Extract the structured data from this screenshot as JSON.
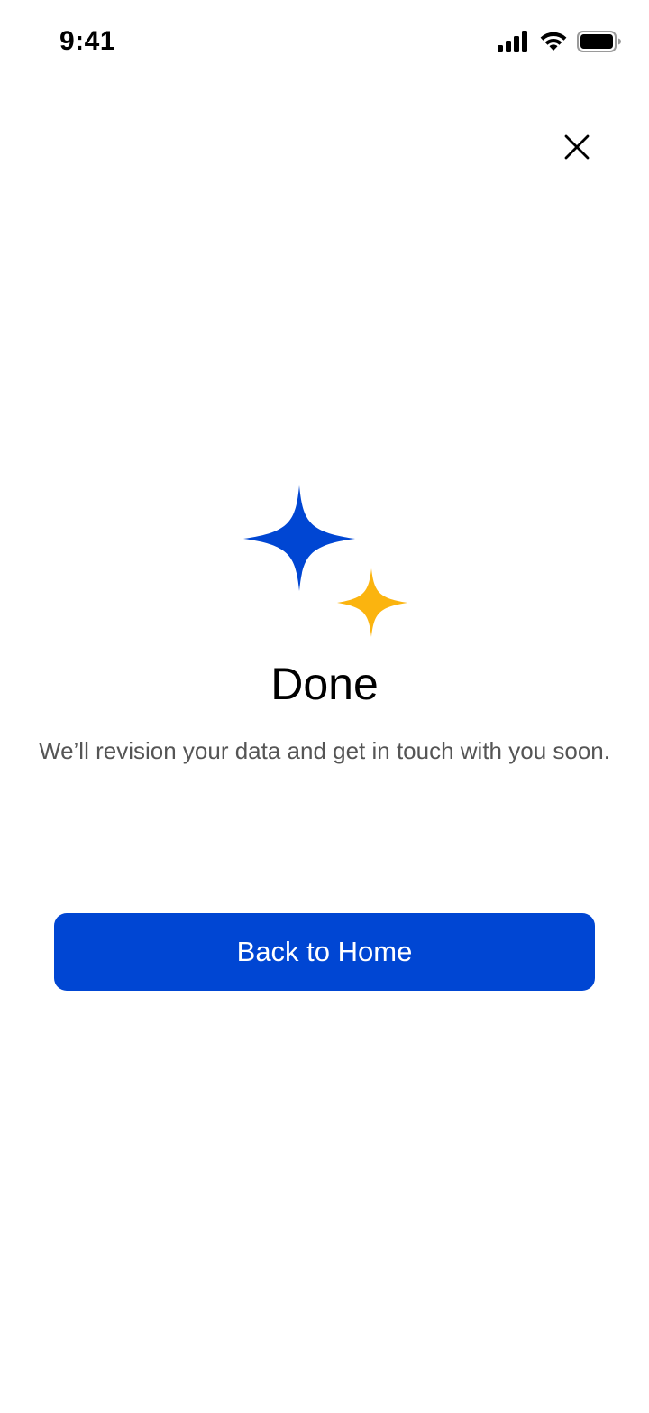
{
  "status_bar": {
    "time": "9:41",
    "icons": [
      "cellular-signal-icon",
      "wifi-icon",
      "battery-icon"
    ]
  },
  "header": {
    "close_icon": "close-icon"
  },
  "illustration": {
    "icon": "sparkles-icon",
    "primary_color": "#0046d3",
    "accent_color": "#fbb40f"
  },
  "content": {
    "title": "Done",
    "message": "We’ll revision your data and get in touch with you soon."
  },
  "actions": {
    "primary_label": "Back to Home",
    "primary_color": "#0046d3"
  }
}
